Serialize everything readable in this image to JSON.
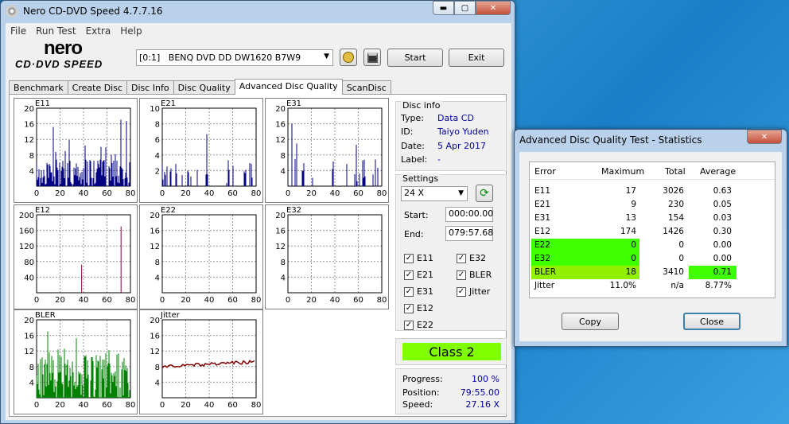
{
  "main_window": {
    "title": "Nero CD-DVD Speed 4.7.7.16",
    "min": "▬",
    "max": "▢",
    "close": "✕",
    "menu": [
      "File",
      "Run Test",
      "Extra",
      "Help"
    ],
    "logo_top": "nero",
    "logo_bottom": "CD·DVD SPEED",
    "drive": "[0:1]   BENQ DVD DD DW1620 B7W9",
    "start": "Start",
    "exit": "Exit",
    "tabs": [
      "Benchmark",
      "Create Disc",
      "Disc Info",
      "Disc Quality",
      "Advanced Disc Quality",
      "ScanDisc"
    ],
    "active_tab": "Advanced Disc Quality"
  },
  "graphs": [
    {
      "name": "E11",
      "yticks": [
        "20",
        "16",
        "12",
        "8",
        "4"
      ],
      "xticks": [
        "0",
        "20",
        "40",
        "60",
        "80"
      ],
      "color": "#000080"
    },
    {
      "name": "E21",
      "yticks": [
        "10",
        "8",
        "6",
        "4",
        "2"
      ],
      "xticks": [
        "0",
        "20",
        "40",
        "60",
        "80"
      ],
      "color": "#000080"
    },
    {
      "name": "E31",
      "yticks": [
        "20",
        "16",
        "12",
        "8",
        "4"
      ],
      "xticks": [
        "0",
        "20",
        "40",
        "60",
        "80"
      ],
      "color": "#000080"
    },
    {
      "name": "E12",
      "yticks": [
        "200",
        "160",
        "120",
        "80",
        "40"
      ],
      "xticks": [
        "0",
        "20",
        "40",
        "60",
        "80"
      ],
      "color": "#800040"
    },
    {
      "name": "E22",
      "yticks": [
        "20",
        "16",
        "12",
        "8",
        "4"
      ],
      "xticks": [
        "0",
        "20",
        "40",
        "60",
        "80"
      ],
      "color": "#000080"
    },
    {
      "name": "E32",
      "yticks": [
        "20",
        "16",
        "12",
        "8",
        "4"
      ],
      "xticks": [
        "0",
        "20",
        "40",
        "60",
        "80"
      ],
      "color": "#000080"
    },
    {
      "name": "BLER",
      "yticks": [
        "20",
        "16",
        "12",
        "8",
        "4"
      ],
      "xticks": [
        "0",
        "20",
        "40",
        "60",
        "80"
      ],
      "color": "#008000"
    },
    {
      "name": "Jitter",
      "yticks": [
        "20",
        "16",
        "12",
        "8",
        "4"
      ],
      "xticks": [
        "0",
        "20",
        "40",
        "60",
        "80"
      ],
      "color": "#800000"
    }
  ],
  "disc_info": {
    "title": "Disc info",
    "type_l": "Type:",
    "type": "Data CD",
    "id_l": "ID:",
    "id": "Taiyo Yuden",
    "date_l": "Date:",
    "date": "5 Apr 2017",
    "label_l": "Label:",
    "label": "-"
  },
  "settings": {
    "title": "Settings",
    "speed": "24 X",
    "start_l": "Start:",
    "start": "000:00.00",
    "end_l": "End:",
    "end": "079:57.68",
    "checks_left": [
      "E11",
      "E21",
      "E31",
      "E12",
      "E22"
    ],
    "checks_right": [
      "E32",
      "BLER",
      "Jitter"
    ],
    "check_mark": "✓"
  },
  "class": {
    "text": "Class 2",
    "color": "#80ff00"
  },
  "progress": {
    "progress_l": "Progress:",
    "progress": "100 %",
    "position_l": "Position:",
    "position": "79:55.00",
    "speed_l": "Speed:",
    "speed": "27.16 X"
  },
  "stats_window": {
    "title": "Advanced Disc Quality Test - Statistics",
    "close": "✕",
    "headers": [
      "Error",
      "Maximum",
      "Total",
      "Average"
    ],
    "rows": [
      {
        "error": "E11",
        "max": "17",
        "total": "3026",
        "avg": "0.63"
      },
      {
        "error": "E21",
        "max": "9",
        "total": "230",
        "avg": "0.05"
      },
      {
        "error": "E31",
        "max": "13",
        "total": "154",
        "avg": "0.03"
      },
      {
        "error": "E12",
        "max": "174",
        "total": "1426",
        "avg": "0.30"
      },
      {
        "error": "E22",
        "max": "0",
        "total": "0",
        "avg": "0.00"
      },
      {
        "error": "E32",
        "max": "0",
        "total": "0",
        "avg": "0.00"
      },
      {
        "error": "BLER",
        "max": "18",
        "total": "3410",
        "avg": "0.71"
      },
      {
        "error": "Jitter",
        "max": "11.0%",
        "total": "n/a",
        "avg": "8.77%"
      }
    ],
    "copy": "Copy",
    "close_btn": "Close"
  }
}
